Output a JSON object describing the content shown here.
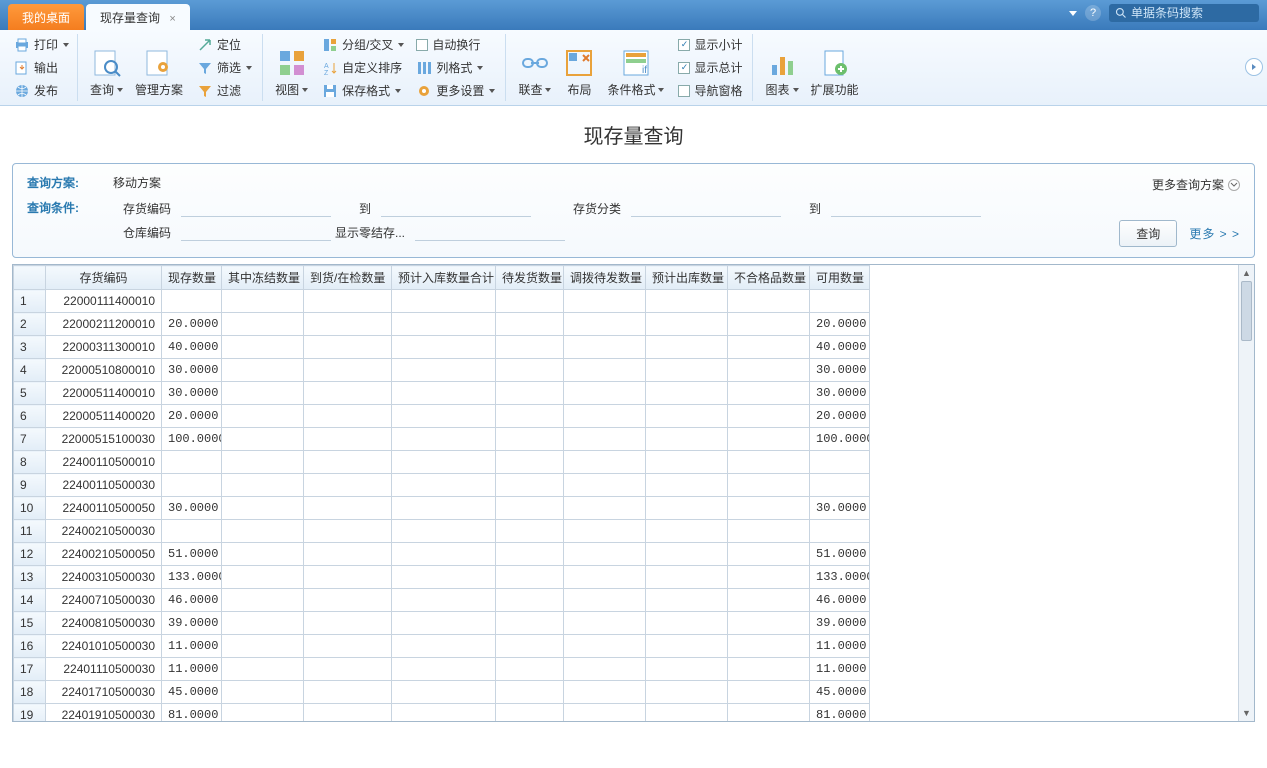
{
  "tabs": {
    "desktop": "我的桌面",
    "current": "现存量查询"
  },
  "search": {
    "placeholder": "单据条码搜索"
  },
  "ribbon": {
    "print": "打印",
    "export": "输出",
    "publish": "发布",
    "query": "查询",
    "mgmt_plan": "管理方案",
    "locate": "定位",
    "filter": "筛选",
    "filter2": "过滤",
    "view": "视图",
    "group": "分组/交叉",
    "custom_sort": "自定义排序",
    "save_format": "保存格式",
    "auto_wrap": "自动换行",
    "col_format": "列格式",
    "more_settings": "更多设置",
    "relate": "联查",
    "layout": "布局",
    "cond_format": "条件格式",
    "show_subtotal": "显示小计",
    "show_total": "显示总计",
    "nav_pane": "导航窗格",
    "chart": "图表",
    "ext_func": "扩展功能"
  },
  "page_title": "现存量查询",
  "query_panel": {
    "plan_label": "查询方案:",
    "plan_value": "移动方案",
    "more_plans": "更多查询方案",
    "cond_label": "查询条件:",
    "stock_code": "存货编码",
    "to": "到",
    "stock_category": "存货分类",
    "warehouse_code": "仓库编码",
    "show_zero": "显示零结存...",
    "btn_query": "查询",
    "more": "更多 > >"
  },
  "columns": [
    "存货编码",
    "现存数量",
    "其中冻结数量",
    "到货/在检数量",
    "预计入库数量合计",
    "待发货数量",
    "调拨待发数量",
    "预计出库数量",
    "不合格品数量",
    "可用数量"
  ],
  "chart_data": {
    "type": "table",
    "columns": [
      "存货编码",
      "现存数量",
      "其中冻结数量",
      "到货/在检数量",
      "预计入库数量合计",
      "待发货数量",
      "调拨待发数量",
      "预计出库数量",
      "不合格品数量",
      "可用数量"
    ],
    "rows": [
      {
        "idx": 1,
        "code": "22000111400010",
        "qty": "",
        "avail": ""
      },
      {
        "idx": 2,
        "code": "22000211200010",
        "qty": "20.0000",
        "avail": "20.0000"
      },
      {
        "idx": 3,
        "code": "22000311300010",
        "qty": "40.0000",
        "avail": "40.0000"
      },
      {
        "idx": 4,
        "code": "22000510800010",
        "qty": "30.0000",
        "avail": "30.0000"
      },
      {
        "idx": 5,
        "code": "22000511400010",
        "qty": "30.0000",
        "avail": "30.0000"
      },
      {
        "idx": 6,
        "code": "22000511400020",
        "qty": "20.0000",
        "avail": "20.0000"
      },
      {
        "idx": 7,
        "code": "22000515100030",
        "qty": "100.0000",
        "avail": "100.0000"
      },
      {
        "idx": 8,
        "code": "22400110500010",
        "qty": "",
        "avail": ""
      },
      {
        "idx": 9,
        "code": "22400110500030",
        "qty": "",
        "avail": ""
      },
      {
        "idx": 10,
        "code": "22400110500050",
        "qty": "30.0000",
        "avail": "30.0000"
      },
      {
        "idx": 11,
        "code": "22400210500030",
        "qty": "",
        "avail": ""
      },
      {
        "idx": 12,
        "code": "22400210500050",
        "qty": "51.0000",
        "avail": "51.0000"
      },
      {
        "idx": 13,
        "code": "22400310500030",
        "qty": "133.0000",
        "avail": "133.0000"
      },
      {
        "idx": 14,
        "code": "22400710500030",
        "qty": "46.0000",
        "avail": "46.0000"
      },
      {
        "idx": 15,
        "code": "22400810500030",
        "qty": "39.0000",
        "avail": "39.0000"
      },
      {
        "idx": 16,
        "code": "22401010500030",
        "qty": "11.0000",
        "avail": "11.0000"
      },
      {
        "idx": 17,
        "code": "22401110500030",
        "qty": "11.0000",
        "avail": "11.0000"
      },
      {
        "idx": 18,
        "code": "22401710500030",
        "qty": "45.0000",
        "avail": "45.0000"
      },
      {
        "idx": 19,
        "code": "22401910500030",
        "qty": "81.0000",
        "avail": "81.0000"
      }
    ]
  }
}
